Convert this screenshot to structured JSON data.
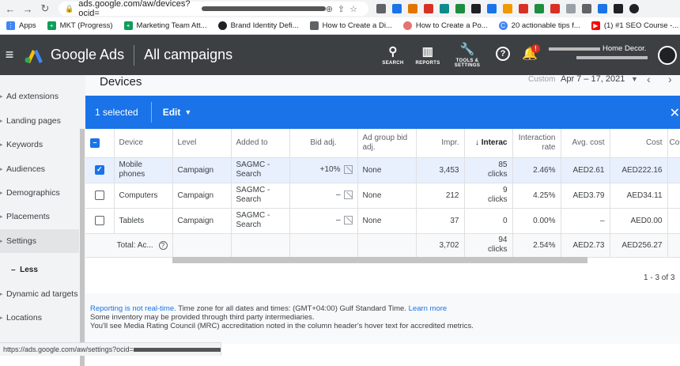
{
  "browser": {
    "url_prefix": "ads.google.com/aw/devices?ocid=",
    "bookmarks": [
      {
        "label": "Apps",
        "color": "#4285f4"
      },
      {
        "label": "MKT (Progress)",
        "color": "#0f9d58"
      },
      {
        "label": "Marketing Team Att...",
        "color": "#0f9d58"
      },
      {
        "label": "Brand Identity Defi...",
        "color": "#202124"
      },
      {
        "label": "How to Create a Di...",
        "color": "#5f6368"
      },
      {
        "label": "How to Create a Po...",
        "color": "#e57373"
      },
      {
        "label": "20 actionable tips f...",
        "color": "#4285f4"
      },
      {
        "label": "(1) #1 SEO Course -...",
        "color": "#ff0000"
      }
    ],
    "status_url": "https://ads.google.com/aw/settings?ocid="
  },
  "header": {
    "product": "Google Ads",
    "page_heading": "All campaigns",
    "tools": [
      {
        "label": "SEARCH",
        "icon": "search-icon"
      },
      {
        "label": "REPORTS",
        "icon": "reports-icon"
      },
      {
        "label": "TOOLS & SETTINGS",
        "icon": "wrench-icon"
      }
    ],
    "notification_count": "!",
    "account_name": "Home Decor."
  },
  "sidebar": {
    "items": [
      {
        "label": "Ad extensions",
        "id": "ad-extensions"
      },
      {
        "label": "Landing pages",
        "id": "landing-pages"
      },
      {
        "label": "Keywords",
        "id": "keywords"
      },
      {
        "label": "Audiences",
        "id": "audiences"
      },
      {
        "label": "Demographics",
        "id": "demographics"
      },
      {
        "label": "Placements",
        "id": "placements"
      },
      {
        "label": "Settings",
        "id": "settings",
        "active": true
      }
    ],
    "less_label": "Less",
    "items_more": [
      {
        "label": "Dynamic ad targets",
        "id": "dynamic-ad-targets"
      },
      {
        "label": "Locations",
        "id": "locations"
      }
    ]
  },
  "main": {
    "title": "Devices",
    "date_label": "Custom",
    "date_range": "Apr 7 – 17, 2021",
    "selection": {
      "count_label": "1 selected",
      "edit_label": "Edit"
    },
    "table": {
      "headers": [
        "Device",
        "Level",
        "Added to",
        "Bid adj.",
        "Ad group bid adj.",
        "Impr.",
        "Interactions",
        "Interaction rate",
        "Avg. cost",
        "Cost",
        "Conversions"
      ],
      "header_display": {
        "interactions": "Interac",
        "conversions": "Con"
      },
      "rows": [
        {
          "device": "Mobile phones",
          "level": "Campaign",
          "added_to": "SAGMC - Search",
          "bid_adj": "+10%",
          "ad_group_bid_adj": "None",
          "impr": "3,453",
          "interactions": "85",
          "interactions_unit": "clicks",
          "rate": "2.46%",
          "avg_cost": "AED2.61",
          "cost": "AED222.16",
          "selected": true
        },
        {
          "device": "Computers",
          "level": "Campaign",
          "added_to": "SAGMC - Search",
          "bid_adj": "–",
          "ad_group_bid_adj": "None",
          "impr": "212",
          "interactions": "9",
          "interactions_unit": "clicks",
          "rate": "4.25%",
          "avg_cost": "AED3.79",
          "cost": "AED34.11",
          "selected": false
        },
        {
          "device": "Tablets",
          "level": "Campaign",
          "added_to": "SAGMC - Search",
          "bid_adj": "–",
          "ad_group_bid_adj": "None",
          "impr": "37",
          "interactions": "0",
          "interactions_unit": "",
          "rate": "0.00%",
          "avg_cost": "–",
          "cost": "AED0.00",
          "selected": false
        }
      ],
      "total": {
        "label": "Total: Ac...",
        "impr": "3,702",
        "interactions": "94",
        "interactions_unit": "clicks",
        "rate": "2.54%",
        "avg_cost": "AED2.73",
        "cost": "AED256.27"
      }
    },
    "pager": "1 - 3 of 3",
    "footnote": {
      "line1_link": "Reporting is not real-time.",
      "line1_text": " Time zone for all dates and times: (GMT+04:00) Gulf Standard Time. ",
      "line1_learn": "Learn more",
      "line2": "Some inventory may be provided through third party intermediaries.",
      "line3": "You'll see Media Rating Council (MRC) accreditation noted in the column header's hover text for accredited metrics."
    }
  },
  "colors": {
    "header_bg": "#3c4043",
    "accent": "#1a73e8",
    "selected_row": "#e8f0fe",
    "sidebar_bg": "#f1f3f4"
  }
}
